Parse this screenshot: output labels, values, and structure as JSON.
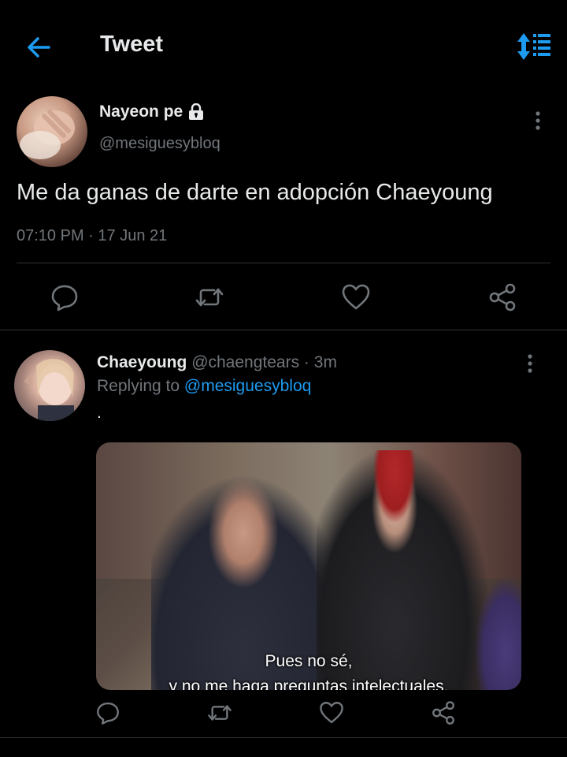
{
  "header": {
    "title": "Tweet",
    "back_icon": "arrow-left-icon",
    "sort_icon": "sort-icon",
    "accent": "#1d9bf0"
  },
  "tweet": {
    "author_name": "Nayeon pe",
    "locked": true,
    "author_handle": "@mesiguesybloq",
    "text": "Me da ganas de darte en adopción Chaeyoung",
    "time": "07:10 PM",
    "date": "17 Jun 21",
    "meta_separator": " · ",
    "actions": [
      "reply-icon",
      "retweet-icon",
      "like-icon",
      "share-icon"
    ]
  },
  "reply": {
    "author_name": "Chaeyoung",
    "author_handle": "@chaengtears",
    "age": "3m",
    "replying_to_label": "Replying to",
    "replying_to_handle": "@mesiguesybloq",
    "text": ".",
    "media": {
      "subtitle_line1": "Pues no sé,",
      "subtitle_line2": "y no me haga preguntas intelectuales."
    },
    "actions": [
      "reply-icon",
      "retweet-icon",
      "like-icon",
      "share-icon"
    ]
  }
}
